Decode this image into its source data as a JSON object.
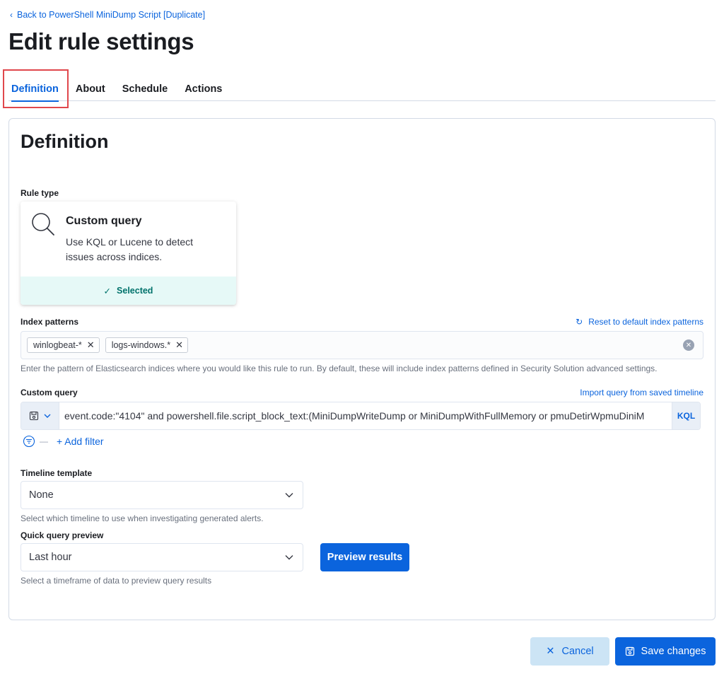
{
  "header": {
    "back_link": "Back to PowerShell MiniDump Script [Duplicate]",
    "title": "Edit rule settings"
  },
  "tabs": [
    {
      "label": "Definition",
      "active": true
    },
    {
      "label": "About",
      "active": false
    },
    {
      "label": "Schedule",
      "active": false
    },
    {
      "label": "Actions",
      "active": false
    }
  ],
  "definition": {
    "section_title": "Definition",
    "rule_type": {
      "label": "Rule type",
      "card_title": "Custom query",
      "card_description": "Use KQL or Lucene to detect issues across indices.",
      "selected_label": "Selected",
      "icon": "magnifier-icon"
    },
    "index_patterns": {
      "label": "Index patterns",
      "reset_link": "Reset to default index patterns",
      "chips": [
        "winlogbeat-*",
        "logs-windows.*"
      ],
      "help": "Enter the pattern of Elasticsearch indices where you would like this rule to run. By default, these will include index patterns defined in Security Solution advanced settings."
    },
    "custom_query": {
      "label": "Custom query",
      "import_link": "Import query from saved timeline",
      "query": "event.code:\"4104\" and powershell.file.script_block_text:(MiniDumpWriteDump or MiniDumpWithFullMemory or pmuDetirWpmuDiniM",
      "language": "KQL",
      "add_filter": "+ Add filter"
    },
    "timeline_template": {
      "label": "Timeline template",
      "value": "None",
      "help": "Select which timeline to use when investigating generated alerts."
    },
    "quick_query_preview": {
      "label": "Quick query preview",
      "value": "Last hour",
      "button": "Preview results",
      "help": "Select a timeframe of data to preview query results"
    }
  },
  "footer": {
    "cancel": "Cancel",
    "save": "Save changes"
  },
  "colors": {
    "accent": "#0b64dd",
    "selected_bg": "#e6f9f7",
    "selected_text": "#00726b",
    "highlight_border": "#e0474c"
  }
}
